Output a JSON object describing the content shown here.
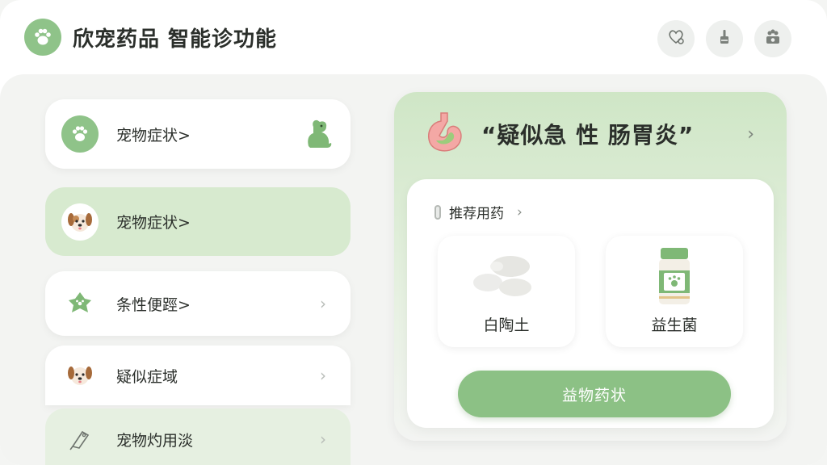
{
  "app": {
    "title": "欣宠药品 智能诊功能"
  },
  "header": {
    "icons": [
      "pet-health-icon",
      "clean-icon",
      "pet-house-icon"
    ]
  },
  "sidebar": {
    "items": [
      {
        "label": "宠物症状>",
        "icon": "paw-icon",
        "active": false
      },
      {
        "label": "宠物症状>",
        "icon": "dog-face-icon",
        "active": true
      },
      {
        "label": "条性便踁>",
        "icon": "heart-paw-icon",
        "active": false
      },
      {
        "label": "疑似症域",
        "icon": "dog-face-icon",
        "active": false
      },
      {
        "label": "宠物灼用淡",
        "icon": "tag-icon",
        "active": false
      }
    ]
  },
  "diagnosis": {
    "title": "“疑似急 性 肠胃炎”",
    "icon": "stomach-icon"
  },
  "recommend": {
    "title": "推荐用药",
    "medicines": [
      {
        "name": "白陶土",
        "icon": "pills-icon"
      },
      {
        "name": "益生菌",
        "icon": "bottle-icon"
      }
    ],
    "button_label": "益物药状"
  },
  "colors": {
    "accent": "#8cc185",
    "active_bg": "#d7eacf",
    "text": "#2b2f2b"
  }
}
